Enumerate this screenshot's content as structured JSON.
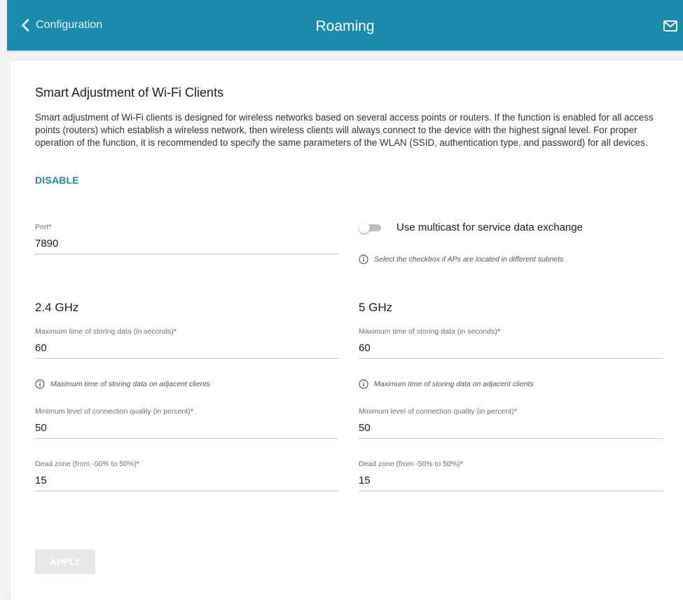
{
  "header": {
    "back_label": "Configuration",
    "title": "Roaming"
  },
  "section": {
    "title": "Smart Adjustment of Wi-Fi Clients",
    "description": "Smart adjustment of Wi-Fi clients is designed for wireless networks based on several access points or routers. If the function is enabled for all access points (routers) which establish a wireless network, then wireless clients will always connect to the device with the highest signal level. For proper operation of the function, it is recommended to specify the same parameters of the WLAN (SSID, authentication type, and password) for all devices.",
    "disable_label": "DISABLE"
  },
  "port": {
    "label": "Port",
    "value": "7890"
  },
  "multicast": {
    "label": "Use multicast for service data exchange",
    "enabled": false,
    "hint": "Select the checkbox if APs are located in different subnets"
  },
  "band_24": {
    "title": "2.4 GHz",
    "max_time": {
      "label": "Maximum time of storing data (in seconds)",
      "value": "60",
      "hint": "Maximum time of storing data on adjacent clients"
    },
    "min_quality": {
      "label": "Minimum level of connection quality (in percent)",
      "value": "50"
    },
    "dead_zone": {
      "label": "Dead zone (from -50% to 50%)",
      "value": "15"
    }
  },
  "band_5": {
    "title": "5 GHz",
    "max_time": {
      "label": "Maximum time of storing data (in seconds)",
      "value": "60",
      "hint": "Maximum time of storing data on adjacent clients"
    },
    "min_quality": {
      "label": "Minimum level of connection quality (in percent)",
      "value": "50"
    },
    "dead_zone": {
      "label": "Dead zone (from -50% to 50%)",
      "value": "15"
    }
  },
  "apply_label": "APPLY",
  "required_mark": "*",
  "colors": {
    "header": "#1a8aad",
    "accent": "#1a8aad",
    "required": "#d32f2f"
  },
  "icons": {
    "back": "chevron-left-icon",
    "mail": "envelope-icon",
    "info": "info-circle-icon"
  }
}
